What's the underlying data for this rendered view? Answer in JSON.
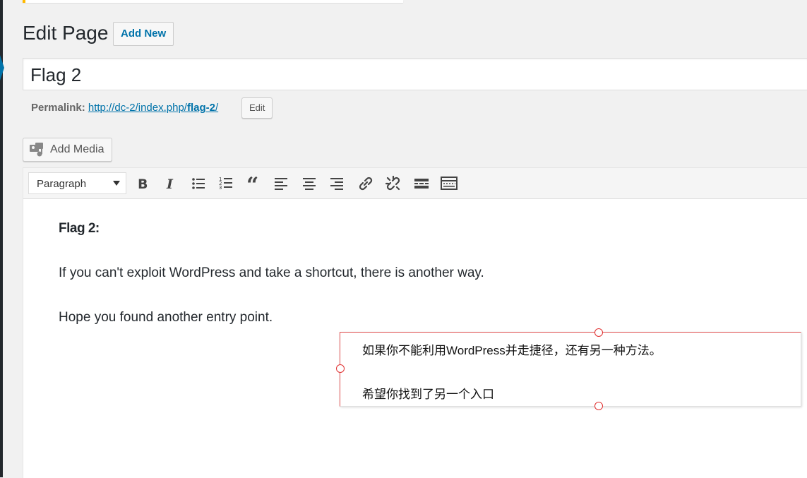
{
  "page": {
    "title": "Edit Page",
    "add_new_label": "Add New"
  },
  "post": {
    "title": "Flag 2",
    "permalink_label": "Permalink:",
    "permalink_base": "http://dc-2/index.php/",
    "permalink_slug": "flag-2",
    "permalink_tail": "/",
    "edit_slug_label": "Edit"
  },
  "media": {
    "add_media_label": "Add Media"
  },
  "toolbar": {
    "format_value": "Paragraph",
    "buttons": [
      "bold-icon",
      "italic-icon",
      "bullet-list-icon",
      "numbered-list-icon",
      "blockquote-icon",
      "align-left-icon",
      "align-center-icon",
      "align-right-icon",
      "link-icon",
      "unlink-icon",
      "read-more-icon",
      "toolbar-toggle-icon"
    ]
  },
  "content": {
    "heading": "Flag 2:",
    "paragraph1": "If you can't exploit WordPress and take a shortcut, there is another way.",
    "paragraph2": "Hope you found another entry point."
  },
  "translation_overlay": {
    "line1": "如果你不能利用WordPress并走捷径，还有另一种方法。",
    "line2": "希望你找到了另一个入口"
  },
  "colors": {
    "link": "#0073aa",
    "notice": "#ffb900",
    "handle": "#e03030"
  }
}
